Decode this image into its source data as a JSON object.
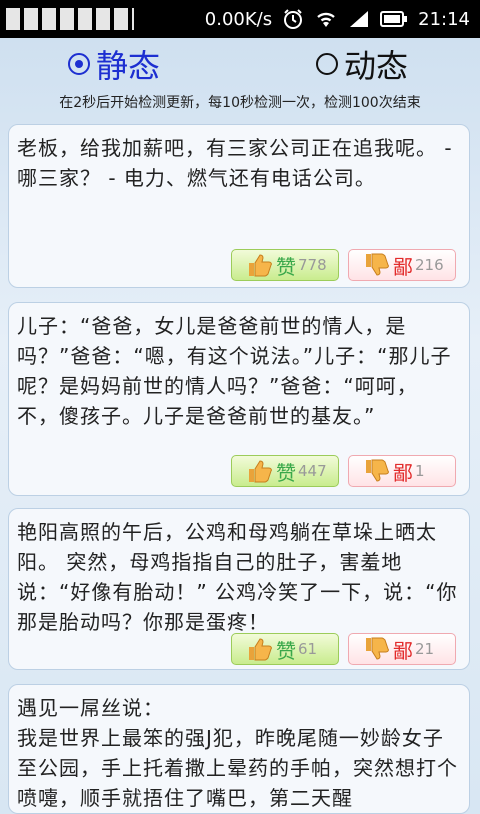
{
  "status_bar": {
    "speed": "0.00K/s",
    "time": "21:14"
  },
  "tabs": [
    {
      "label": "静态",
      "selected": true
    },
    {
      "label": "动态",
      "selected": false
    }
  ],
  "hint": "在2秒后开始检测更新，每10秒检测一次，检测100次结束",
  "colors": {
    "selected_tab": "#1d2fd1",
    "like": "#3aa84a",
    "dislike": "#e22b2b"
  },
  "cards": [
    {
      "text": "老板，给我加薪吧，有三家公司正在追我呢。 - 哪三家？ - 电力、燃气还有电话公司。",
      "like_label": "赞",
      "like_count": "778",
      "dislike_label": "鄙",
      "dislike_count": "216"
    },
    {
      "text": "儿子：“爸爸，女儿是爸爸前世的情人，是吗？”爸爸：“嗯，有这个说法。”儿子：“那儿子呢？是妈妈前世的情人吗？”爸爸：“呵呵，不，傻孩子。儿子是爸爸前世的基友。”",
      "like_label": "赞",
      "like_count": "447",
      "dislike_label": "鄙",
      "dislike_count": "1"
    },
    {
      "text": "艳阳高照的午后，公鸡和母鸡躺在草垛上晒太阳。 突然，母鸡指指自己的肚子，害羞地说：“好像有胎动！” 公鸡冷笑了一下，说：“你那是胎动吗？你那是蛋疼！",
      "like_label": "赞",
      "like_count": "61",
      "dislike_label": "鄙",
      "dislike_count": "21"
    },
    {
      "text": "遇见一屌丝说：\n我是世界上最笨的强J犯，昨晚尾随一妙龄女子至公园，手上托着撒上晕药的手帕，突然想打个喷嚏，顺手就捂住了嘴巴，第二天醒"
    }
  ]
}
